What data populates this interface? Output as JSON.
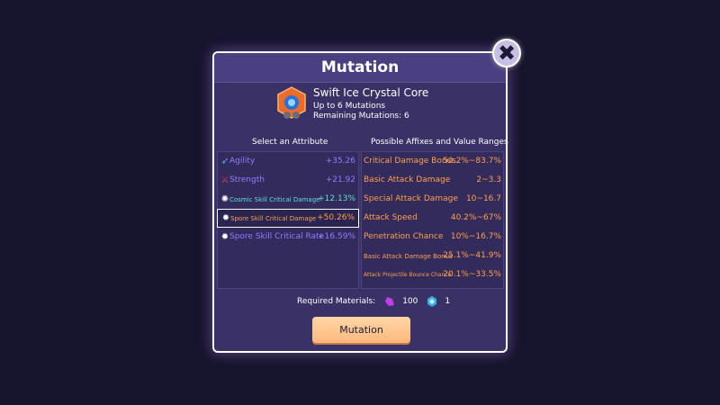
{
  "modal": {
    "title": "Mutation"
  },
  "close": {
    "symbol": "✖"
  },
  "core": {
    "name": "Swift Ice Crystal Core",
    "limit": "Up to 6 Mutations",
    "remaining": "Remaining Mutations: 6"
  },
  "attributes": {
    "header": "Select an Attribute",
    "items": [
      {
        "label": "Agility",
        "value": "+35.26",
        "icon": "agility-icon",
        "color": "#6e8cff"
      },
      {
        "label": "Strength",
        "value": "+21.92",
        "icon": "strength-icon",
        "color": "#6e8cff"
      },
      {
        "label": "Cosmic Skill Critical Damage",
        "value": "+12.13%",
        "icon": "cosmic-skill-icon",
        "color": "#5fe0d0"
      },
      {
        "label": "Spore Skill Critical Damage",
        "value": "+50.26%",
        "icon": "spore-skill-icon",
        "color": "#ffa04a"
      },
      {
        "label": "Spore Skill Critical Rate",
        "value": "+16.59%",
        "icon": "spore-skill-icon",
        "color": "#8f7dff"
      }
    ]
  },
  "affixes": {
    "header": "Possible Affixes and Value Ranges",
    "items": [
      {
        "label": "Critical Damage Bonus",
        "range": "50.2%~83.7%"
      },
      {
        "label": "Basic Attack Damage",
        "range": "2~3.3"
      },
      {
        "label": "Special Attack Damage",
        "range": "10~16.7"
      },
      {
        "label": "Attack Speed",
        "range": "40.2%~67%"
      },
      {
        "label": "Penetration Chance",
        "range": "10%~16.7%"
      },
      {
        "label": "Basic Attack Damage Bonus",
        "range": "25.1%~41.9%"
      },
      {
        "label": "Attack Projectile Bounce Chance",
        "range": "20.1%~33.5%"
      }
    ]
  },
  "materials": {
    "label": "Required Materials:",
    "items": [
      {
        "icon": "purple-crystal-icon",
        "count": "100"
      },
      {
        "icon": "ice-crystal-icon",
        "count": "1"
      }
    ]
  },
  "action": {
    "label": "Mutation"
  },
  "colors": {
    "accent": "#ffa04a",
    "panel": "#3a3266",
    "background": "#17142e"
  }
}
